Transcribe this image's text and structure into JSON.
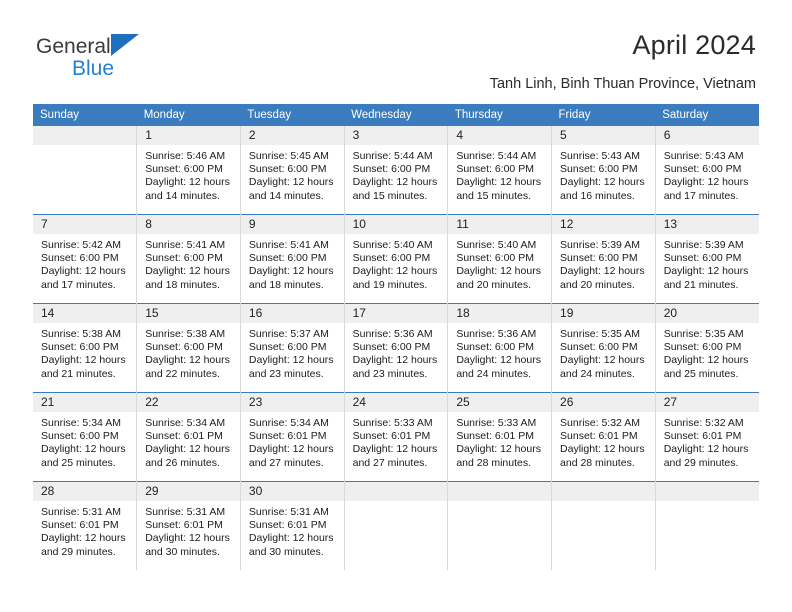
{
  "brand": {
    "word1": "General",
    "word2": "Blue",
    "triangle_color": "#1f6fc0",
    "word2_color": "#2280d6"
  },
  "header": {
    "title": "April 2024",
    "subtitle": "Tanh Linh, Binh Thuan Province, Vietnam",
    "header_bg": "#3a7cbe",
    "daynum_bg": "#efefef"
  },
  "calendar": {
    "weekday_headers": [
      "Sunday",
      "Monday",
      "Tuesday",
      "Wednesday",
      "Thursday",
      "Friday",
      "Saturday"
    ],
    "weeks": [
      [
        {
          "day": "",
          "lines": []
        },
        {
          "day": "1",
          "lines": [
            "Sunrise: 5:46 AM",
            "Sunset: 6:00 PM",
            "Daylight: 12 hours",
            "and 14 minutes."
          ]
        },
        {
          "day": "2",
          "lines": [
            "Sunrise: 5:45 AM",
            "Sunset: 6:00 PM",
            "Daylight: 12 hours",
            "and 14 minutes."
          ]
        },
        {
          "day": "3",
          "lines": [
            "Sunrise: 5:44 AM",
            "Sunset: 6:00 PM",
            "Daylight: 12 hours",
            "and 15 minutes."
          ]
        },
        {
          "day": "4",
          "lines": [
            "Sunrise: 5:44 AM",
            "Sunset: 6:00 PM",
            "Daylight: 12 hours",
            "and 15 minutes."
          ]
        },
        {
          "day": "5",
          "lines": [
            "Sunrise: 5:43 AM",
            "Sunset: 6:00 PM",
            "Daylight: 12 hours",
            "and 16 minutes."
          ]
        },
        {
          "day": "6",
          "lines": [
            "Sunrise: 5:43 AM",
            "Sunset: 6:00 PM",
            "Daylight: 12 hours",
            "and 17 minutes."
          ]
        }
      ],
      [
        {
          "day": "7",
          "lines": [
            "Sunrise: 5:42 AM",
            "Sunset: 6:00 PM",
            "Daylight: 12 hours",
            "and 17 minutes."
          ]
        },
        {
          "day": "8",
          "lines": [
            "Sunrise: 5:41 AM",
            "Sunset: 6:00 PM",
            "Daylight: 12 hours",
            "and 18 minutes."
          ]
        },
        {
          "day": "9",
          "lines": [
            "Sunrise: 5:41 AM",
            "Sunset: 6:00 PM",
            "Daylight: 12 hours",
            "and 18 minutes."
          ]
        },
        {
          "day": "10",
          "lines": [
            "Sunrise: 5:40 AM",
            "Sunset: 6:00 PM",
            "Daylight: 12 hours",
            "and 19 minutes."
          ]
        },
        {
          "day": "11",
          "lines": [
            "Sunrise: 5:40 AM",
            "Sunset: 6:00 PM",
            "Daylight: 12 hours",
            "and 20 minutes."
          ]
        },
        {
          "day": "12",
          "lines": [
            "Sunrise: 5:39 AM",
            "Sunset: 6:00 PM",
            "Daylight: 12 hours",
            "and 20 minutes."
          ]
        },
        {
          "day": "13",
          "lines": [
            "Sunrise: 5:39 AM",
            "Sunset: 6:00 PM",
            "Daylight: 12 hours",
            "and 21 minutes."
          ]
        }
      ],
      [
        {
          "day": "14",
          "lines": [
            "Sunrise: 5:38 AM",
            "Sunset: 6:00 PM",
            "Daylight: 12 hours",
            "and 21 minutes."
          ]
        },
        {
          "day": "15",
          "lines": [
            "Sunrise: 5:38 AM",
            "Sunset: 6:00 PM",
            "Daylight: 12 hours",
            "and 22 minutes."
          ]
        },
        {
          "day": "16",
          "lines": [
            "Sunrise: 5:37 AM",
            "Sunset: 6:00 PM",
            "Daylight: 12 hours",
            "and 23 minutes."
          ]
        },
        {
          "day": "17",
          "lines": [
            "Sunrise: 5:36 AM",
            "Sunset: 6:00 PM",
            "Daylight: 12 hours",
            "and 23 minutes."
          ]
        },
        {
          "day": "18",
          "lines": [
            "Sunrise: 5:36 AM",
            "Sunset: 6:00 PM",
            "Daylight: 12 hours",
            "and 24 minutes."
          ]
        },
        {
          "day": "19",
          "lines": [
            "Sunrise: 5:35 AM",
            "Sunset: 6:00 PM",
            "Daylight: 12 hours",
            "and 24 minutes."
          ]
        },
        {
          "day": "20",
          "lines": [
            "Sunrise: 5:35 AM",
            "Sunset: 6:00 PM",
            "Daylight: 12 hours",
            "and 25 minutes."
          ]
        }
      ],
      [
        {
          "day": "21",
          "lines": [
            "Sunrise: 5:34 AM",
            "Sunset: 6:00 PM",
            "Daylight: 12 hours",
            "and 25 minutes."
          ]
        },
        {
          "day": "22",
          "lines": [
            "Sunrise: 5:34 AM",
            "Sunset: 6:01 PM",
            "Daylight: 12 hours",
            "and 26 minutes."
          ]
        },
        {
          "day": "23",
          "lines": [
            "Sunrise: 5:34 AM",
            "Sunset: 6:01 PM",
            "Daylight: 12 hours",
            "and 27 minutes."
          ]
        },
        {
          "day": "24",
          "lines": [
            "Sunrise: 5:33 AM",
            "Sunset: 6:01 PM",
            "Daylight: 12 hours",
            "and 27 minutes."
          ]
        },
        {
          "day": "25",
          "lines": [
            "Sunrise: 5:33 AM",
            "Sunset: 6:01 PM",
            "Daylight: 12 hours",
            "and 28 minutes."
          ]
        },
        {
          "day": "26",
          "lines": [
            "Sunrise: 5:32 AM",
            "Sunset: 6:01 PM",
            "Daylight: 12 hours",
            "and 28 minutes."
          ]
        },
        {
          "day": "27",
          "lines": [
            "Sunrise: 5:32 AM",
            "Sunset: 6:01 PM",
            "Daylight: 12 hours",
            "and 29 minutes."
          ]
        }
      ],
      [
        {
          "day": "28",
          "lines": [
            "Sunrise: 5:31 AM",
            "Sunset: 6:01 PM",
            "Daylight: 12 hours",
            "and 29 minutes."
          ]
        },
        {
          "day": "29",
          "lines": [
            "Sunrise: 5:31 AM",
            "Sunset: 6:01 PM",
            "Daylight: 12 hours",
            "and 30 minutes."
          ]
        },
        {
          "day": "30",
          "lines": [
            "Sunrise: 5:31 AM",
            "Sunset: 6:01 PM",
            "Daylight: 12 hours",
            "and 30 minutes."
          ]
        },
        {
          "day": "",
          "lines": []
        },
        {
          "day": "",
          "lines": []
        },
        {
          "day": "",
          "lines": []
        },
        {
          "day": "",
          "lines": []
        }
      ]
    ]
  }
}
